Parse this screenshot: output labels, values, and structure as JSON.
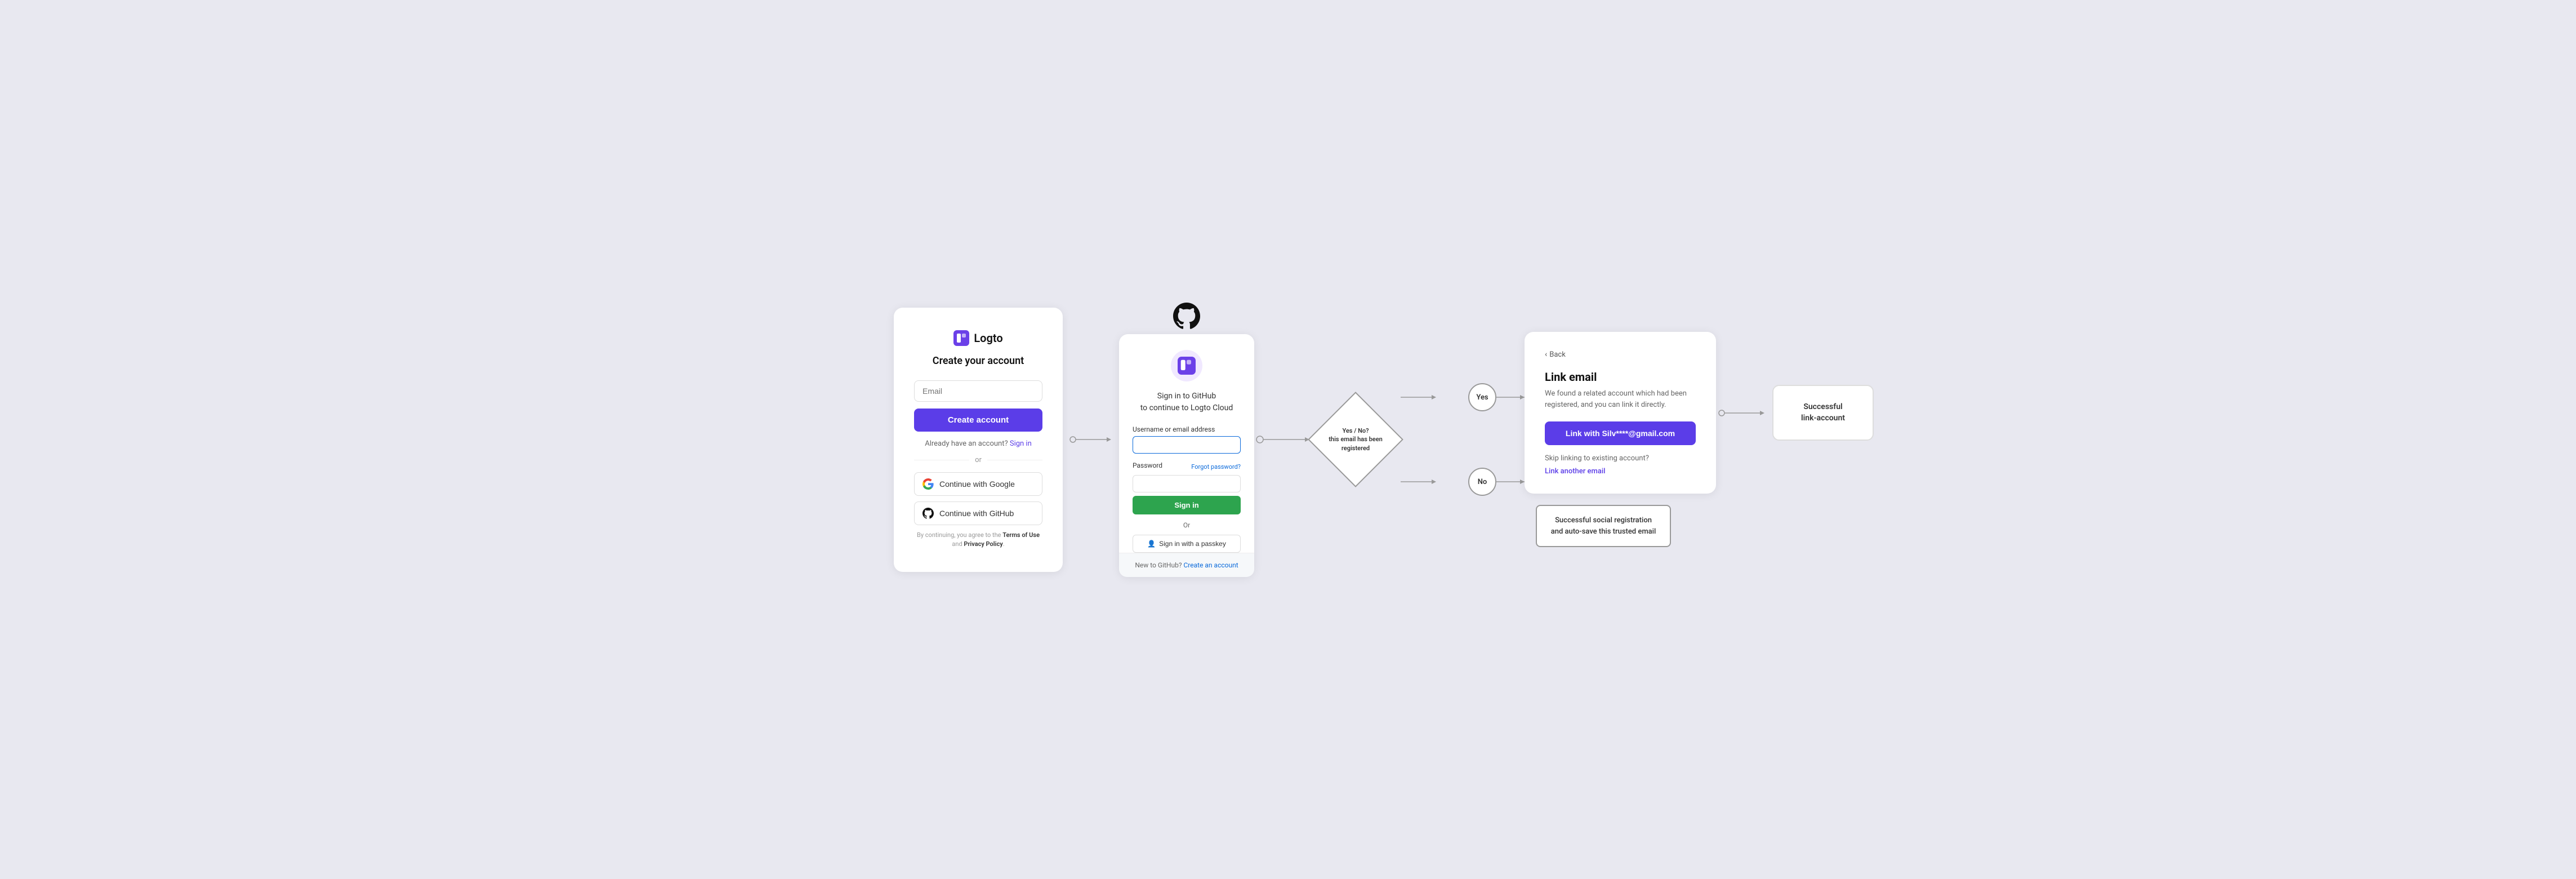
{
  "card1": {
    "logo_text": "Logto",
    "title": "Create your account",
    "email_placeholder": "Email",
    "create_account_btn": "Create account",
    "sign_in_prompt": "Already have an account?",
    "sign_in_link": "Sign in",
    "divider_text": "or",
    "google_btn": "Continue with Google",
    "github_btn": "Continue with GitHub",
    "terms_prefix": "By continuing, you agree to the",
    "terms_link": "Terms of Use",
    "terms_and": "and",
    "privacy_link": "Privacy Policy"
  },
  "card2": {
    "icon_top": "github-octocat",
    "logo_alt": "logto-logo",
    "sign_in_title_line1": "Sign in to GitHub",
    "sign_in_title_line2": "to continue to Logto Cloud",
    "username_label": "Username or email address",
    "password_label": "Password",
    "forgot_password": "Forgot password?",
    "signin_btn": "Sign in",
    "or_text": "Or",
    "passkey_btn": "Sign in with a passkey",
    "new_text": "New to GitHub?",
    "create_account_link": "Create an account"
  },
  "flowchart": {
    "diamond_text": "Yes / No?\nthis email has been\nregistered",
    "yes_label": "Yes",
    "no_label": "No"
  },
  "card3": {
    "back_text": "Back",
    "title": "Link email",
    "description": "We found a related account which had been registered, and you can link it directly.",
    "link_btn": "Link with Silv****@gmail.com",
    "skip_text": "Skip linking to existing account?",
    "link_another": "Link another email"
  },
  "card4": {
    "title": "Successful\nlink-account"
  },
  "success_box": {
    "text": "Successful social registration\nand auto-save this trusted email"
  }
}
